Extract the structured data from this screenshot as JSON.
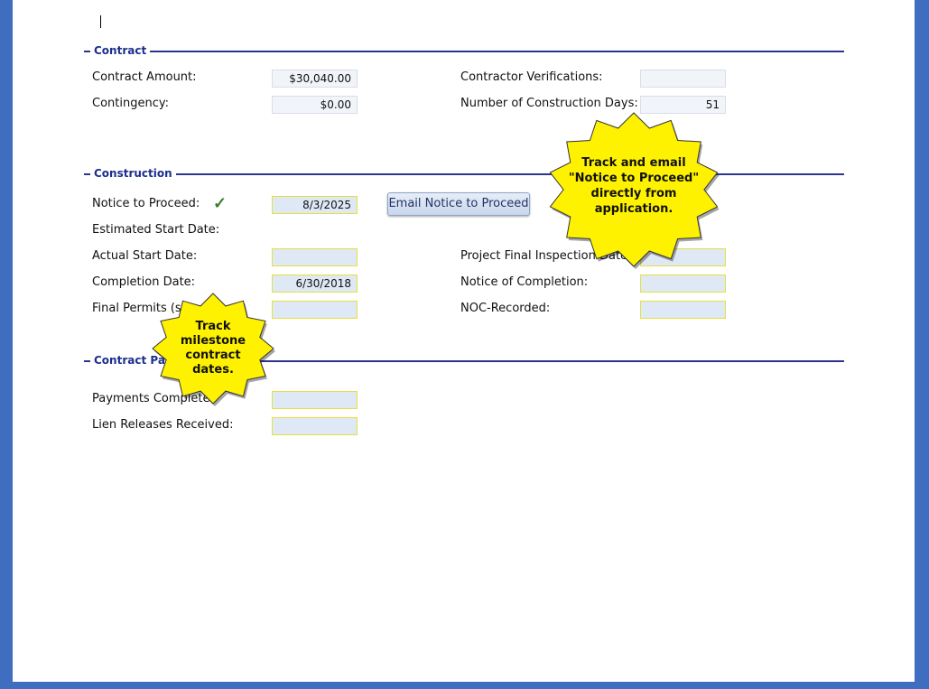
{
  "sections": {
    "contract": "Contract",
    "construction": "Construction",
    "payments": "Contract Payments"
  },
  "contract": {
    "amount_label": "Contract Amount:",
    "amount_value": "$30,040.00",
    "contingency_label": "Contingency:",
    "contingency_value": "$0.00",
    "verifications_label": "Contractor Verifications:",
    "verifications_value": "",
    "days_label": "Number of Construction Days:",
    "days_value": "51"
  },
  "construction": {
    "ntp_label": "Notice to Proceed:",
    "ntp_value": "8/3/2025",
    "email_button": "Email Notice to Proceed",
    "est_start_label": "Estimated Start Date:",
    "actual_start_label": "Actual Start Date:",
    "actual_start_value": "",
    "inspection_label": "Project Final Inspection Date:",
    "inspection_value": "",
    "completion_label": "Completion Date:",
    "completion_value": "6/30/2018",
    "noc_label": "Notice of Completion:",
    "noc_value": "",
    "permits_label": "Final Permits (s",
    "permits_value": "",
    "noc_recorded_label": "NOC-Recorded:",
    "noc_recorded_value": ""
  },
  "payments": {
    "complete_label": "Payments Complete:",
    "complete_value": "",
    "lien_label": "Lien Releases Received:",
    "lien_value": ""
  },
  "callouts": {
    "email": [
      "Track and email",
      "\"Notice to Proceed\"",
      "directly from",
      "application."
    ],
    "milestone": [
      "Track",
      "milestone",
      "contract",
      "dates."
    ]
  },
  "colors": {
    "frame": "#3f6dbf",
    "section_rule": "#2a3590",
    "callout_fill": "#fff200",
    "date_field_border": "#e6e03a",
    "check": "#3f7d2d"
  }
}
